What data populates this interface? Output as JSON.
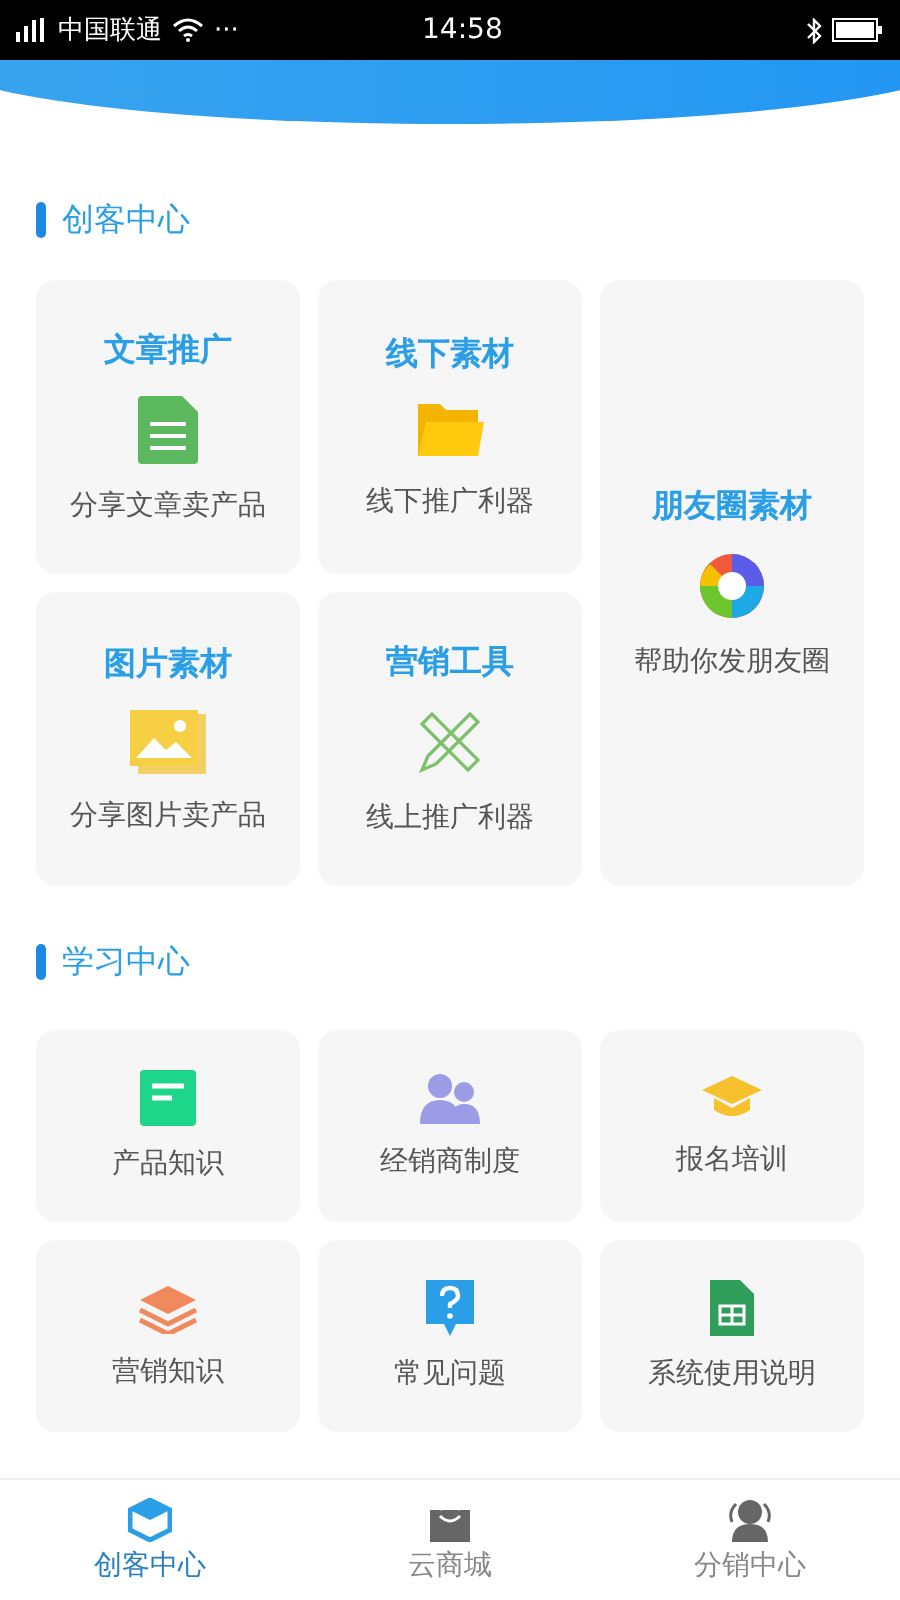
{
  "status_bar": {
    "carrier": "中国联通",
    "dots": "···",
    "time": "14:58"
  },
  "sections": [
    {
      "title": "创客中心",
      "kind": "feature",
      "items": [
        {
          "title": "文章推广",
          "subtitle": "分享文章卖产品",
          "kind": "normal"
        },
        {
          "title": "线下素材",
          "subtitle": "线下推广利器",
          "kind": "normal"
        },
        {
          "title": "朋友圈素材",
          "subtitle": "帮助你发朋友圈",
          "kind": "tall"
        },
        {
          "title": "图片素材",
          "subtitle": "分享图片卖产品",
          "kind": "normal"
        },
        {
          "title": "营销工具",
          "subtitle": "线上推广利器",
          "kind": "normal"
        }
      ]
    },
    {
      "title": "学习中心",
      "kind": "simple",
      "items": [
        {
          "subtitle": "产品知识"
        },
        {
          "subtitle": "经销商制度"
        },
        {
          "subtitle": "报名培训"
        },
        {
          "subtitle": "营销知识"
        },
        {
          "subtitle": "常见问题"
        },
        {
          "subtitle": "系统使用说明"
        }
      ]
    }
  ],
  "tabs": [
    {
      "label": "创客中心",
      "selected": true
    },
    {
      "label": "云商城",
      "selected": false
    },
    {
      "label": "分销中心",
      "selected": false
    }
  ]
}
